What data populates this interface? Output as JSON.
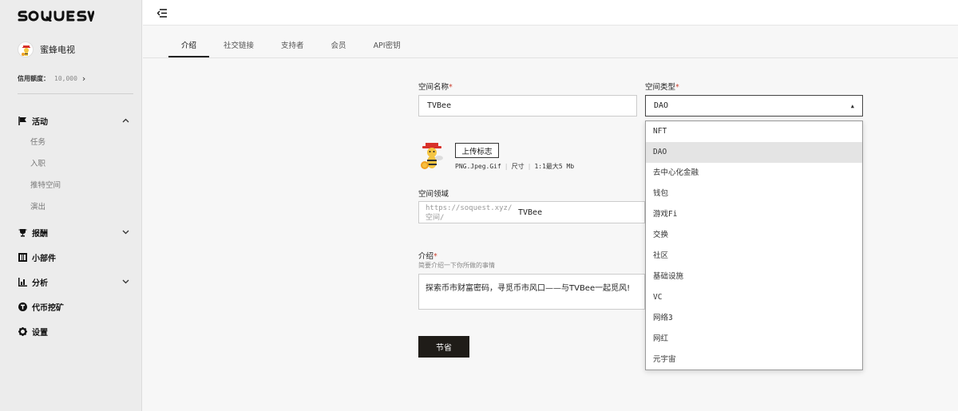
{
  "sidebar": {
    "logo": "SOQUEST",
    "user_name": "蜜蜂电视",
    "credit_label": "信用额度：",
    "credit_value": "10,000",
    "nav": {
      "activity": {
        "label": "活动",
        "sub": [
          "任务",
          "入职",
          "推特空间",
          "演出"
        ]
      },
      "rewards": {
        "label": "报酬"
      },
      "widgets": {
        "label": "小部件"
      },
      "analytics": {
        "label": "分析"
      },
      "mining": {
        "label": "代币挖矿"
      },
      "settings": {
        "label": "设置"
      }
    }
  },
  "tabs": [
    "介绍",
    "社交链接",
    "支持者",
    "会员",
    "API密钥"
  ],
  "form": {
    "space_name_label": "空间名称",
    "space_name_value": "TVBee",
    "space_type_label": "空间类型",
    "space_type_value": "DAO",
    "upload_button": "上传标志",
    "upload_formats": "PNG.Jpeg.Gif",
    "upload_size_label": "尺寸",
    "upload_size_value": "1:1最大5 Mb",
    "domain_label": "空间领域",
    "domain_prefix_line1": "https://soquest.xyz/",
    "domain_prefix_line2": "空间/",
    "domain_value": "TVBee",
    "intro_label": "介绍",
    "intro_sub": "简要介绍一下你所做的事情",
    "intro_value": "探索币市财富密码，寻觅币市风口——与TVBee一起觅风!",
    "save_button": "节省",
    "required_mark": "*"
  },
  "dropdown_options": [
    "NFT",
    "DAO",
    "去中心化金融",
    "钱包",
    "游戏Fi",
    "交换",
    "社区",
    "基础设施",
    "VC",
    "网络3",
    "网红",
    "元宇宙"
  ]
}
